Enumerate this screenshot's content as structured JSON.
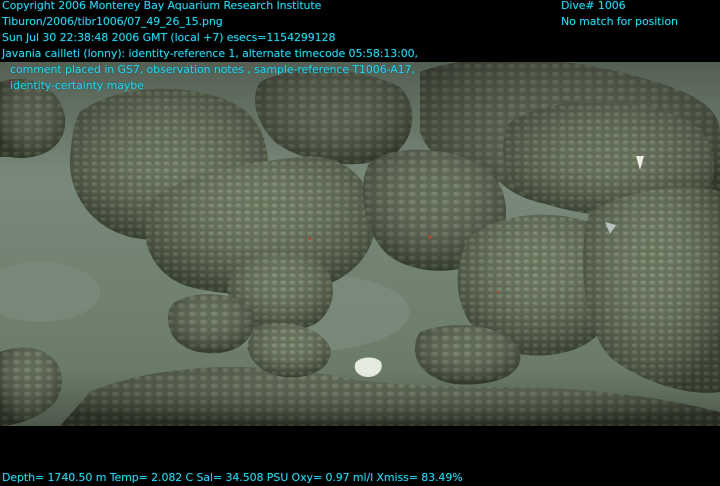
{
  "overlay": {
    "copyright": "Copyright 2006 Monterey Bay Aquarium Research Institute",
    "filename": "Tiburon/2006/tibr1006/07_49_26_15.png",
    "timestamp": "Sun Jul 30 22:38:48 2006 GMT (local +7)  esecs=1154299128",
    "annotation_line1": "Javania cailleti (lonny): identity-reference 1, alternate timecode 05:58:13:00,",
    "annotation_line2": "comment placed in GS7, observation notes , sample-reference T1006-A17,",
    "annotation_line3": "identity-certainty maybe",
    "dive": "Dive# 1006",
    "position_status": "No match for position",
    "sensors": "Depth= 1740.50 m  Temp= 2.082 C  Sal= 34.508 PSU  Oxy= 0.97 ml/l  Xmiss= 83.49%"
  },
  "colors": {
    "overlay_text": "#27d6f0",
    "letterbox": "#000000",
    "sediment": "#76867a",
    "rock": "#4f5b45"
  }
}
